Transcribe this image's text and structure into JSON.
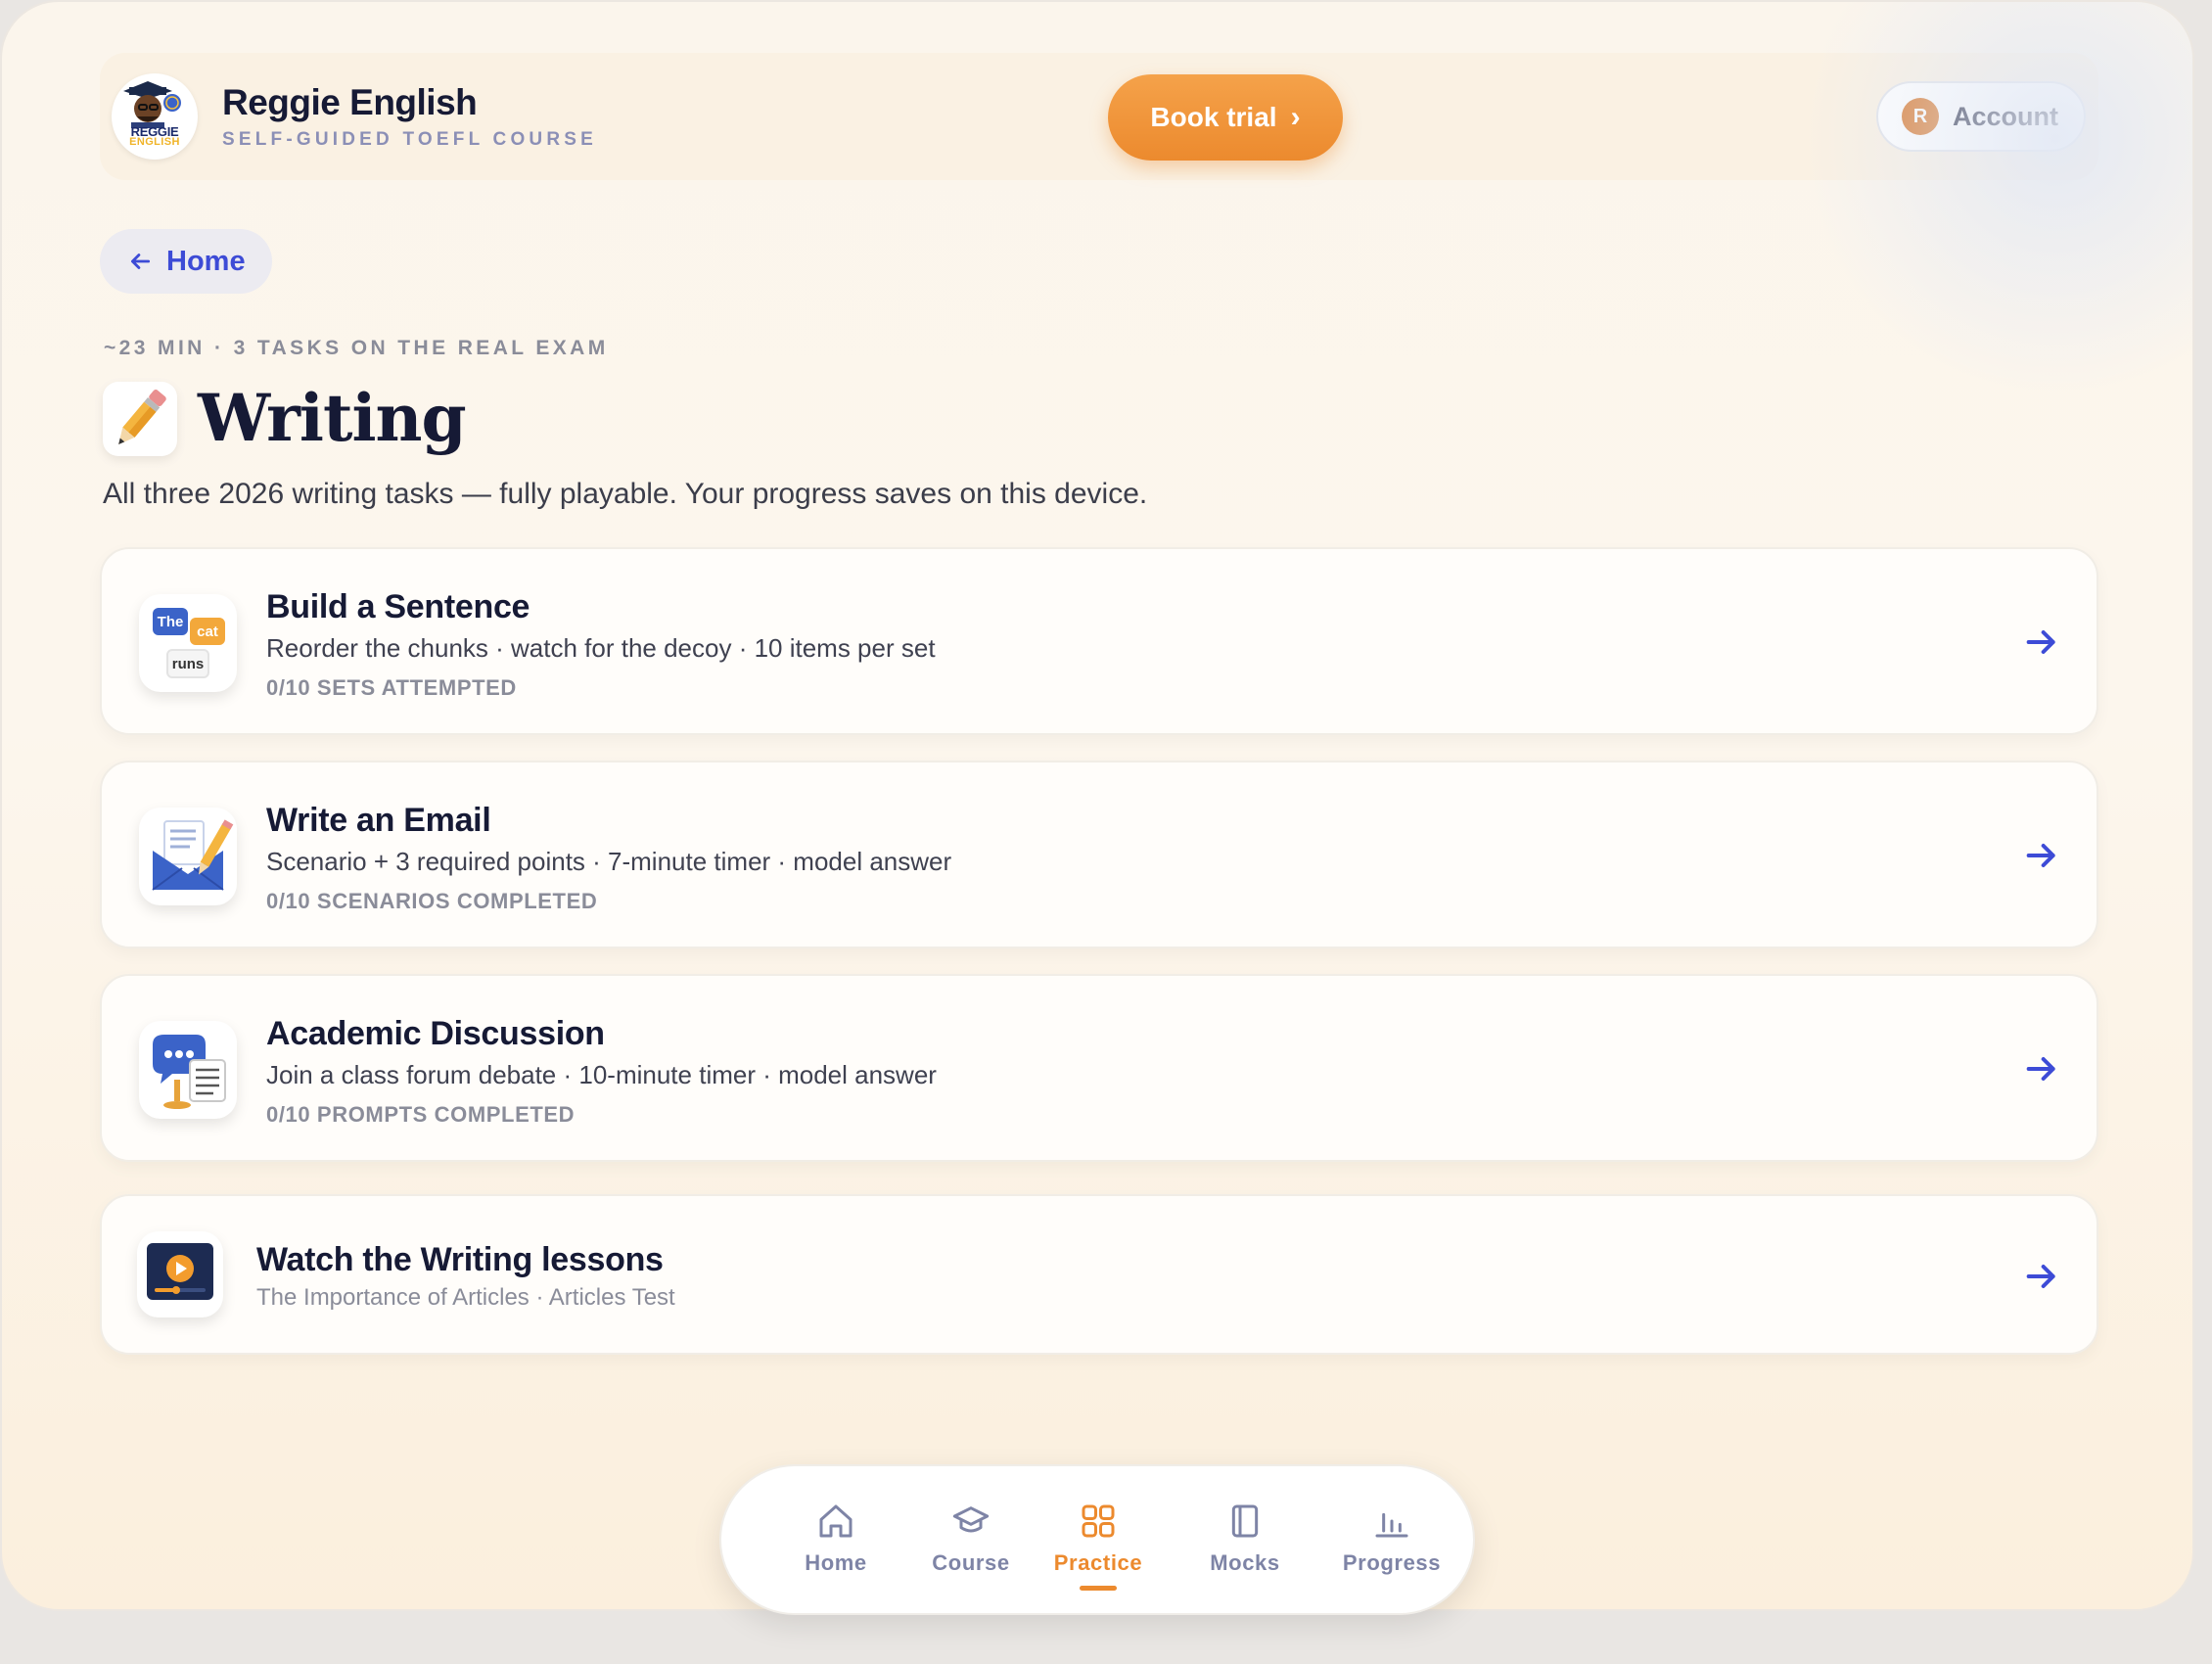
{
  "header": {
    "logo_text_top": "REGGIE",
    "logo_text_bottom": "ENGLISH",
    "brand_name": "Reggie English",
    "brand_sub": "SELF-GUIDED TOEFL COURSE",
    "book_trial_label": "Book trial",
    "book_trial_chevron": "›",
    "account_initial": "R",
    "account_label": "Account"
  },
  "back": {
    "label": "Home"
  },
  "page": {
    "meta": "~23 MIN · 3 TASKS ON THE REAL EXAM",
    "title": "Writing",
    "subtitle": "All three 2026 writing tasks — fully playable. Your progress saves on this device."
  },
  "cards": [
    {
      "title": "Build a Sentence",
      "desc": "Reorder the chunks · watch for the decoy · 10 items per set",
      "progress": "0/10 SETS ATTEMPTED",
      "icon": "word-blocks-icon",
      "icon_words": [
        "The",
        "cat",
        "runs"
      ]
    },
    {
      "title": "Write an Email",
      "desc": "Scenario + 3 required points · 7-minute timer · model answer",
      "progress": "0/10 SCENARIOS COMPLETED",
      "icon": "email-pencil-icon"
    },
    {
      "title": "Academic Discussion",
      "desc": "Join a class forum debate · 10-minute timer · model answer",
      "progress": "0/10 PROMPTS COMPLETED",
      "icon": "discussion-forum-icon"
    },
    {
      "title": "Watch the Writing lessons",
      "desc": "The Importance of Articles · Articles Test",
      "icon": "video-lesson-icon"
    }
  ],
  "bottom_nav": {
    "items": [
      {
        "label": "Home",
        "icon": "home-icon",
        "active": false
      },
      {
        "label": "Course",
        "icon": "graduation-cap-icon",
        "active": false
      },
      {
        "label": "Practice",
        "icon": "grid-icon",
        "active": true
      },
      {
        "label": "Mocks",
        "icon": "book-icon",
        "active": false
      },
      {
        "label": "Progress",
        "icon": "bar-chart-icon",
        "active": false
      }
    ]
  },
  "colors": {
    "accent_orange": "#ec8a2e",
    "link_blue": "#3d4bd6",
    "text_dark": "#161a35",
    "muted": "#8a8c99",
    "nav_muted": "#7e84a6"
  }
}
